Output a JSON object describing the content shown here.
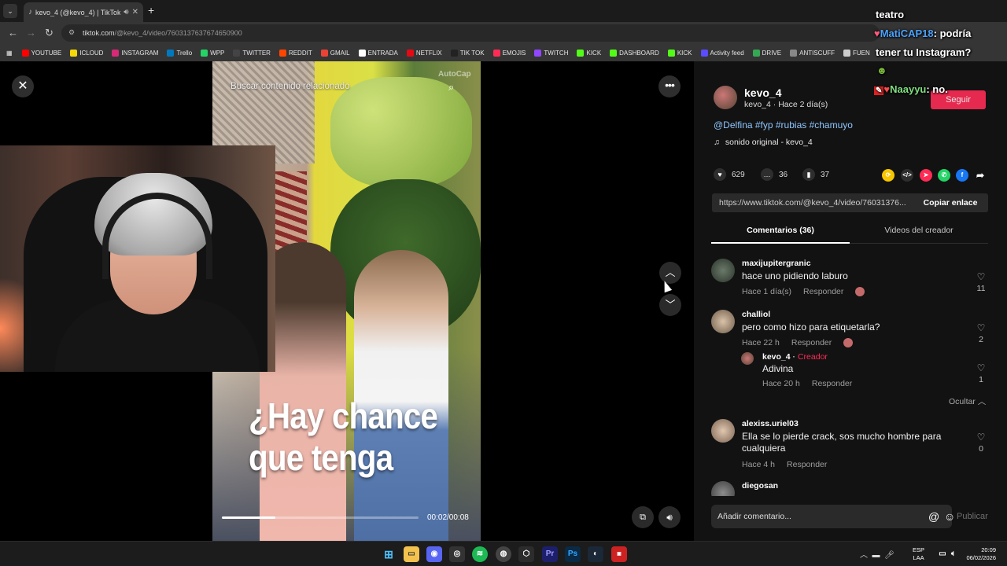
{
  "browser": {
    "tab_title": "kevo_4 (@kevo_4) | TikTok",
    "new_tab_icon": "plus-icon",
    "url_domain": "tiktok.com",
    "url_path": "/@kevo_4/video/7603137637674650900",
    "bookmarks": [
      {
        "label": "YOUTUBE",
        "color": "#ff0000"
      },
      {
        "label": "ICLOUD",
        "color": "#f5d90a"
      },
      {
        "label": "INSTAGRAM",
        "color": "#d62976"
      },
      {
        "label": "Trello",
        "color": "#0079bf"
      },
      {
        "label": "WPP",
        "color": "#25d366"
      },
      {
        "label": "TWITTER",
        "color": "#444444"
      },
      {
        "label": "REDDIT",
        "color": "#ff4500"
      },
      {
        "label": "GMAIL",
        "color": "#ea4335"
      },
      {
        "label": "ENTRADA",
        "color": "#ffffff"
      },
      {
        "label": "NETFLIX",
        "color": "#e50914"
      },
      {
        "label": "TIK TOK",
        "color": "#222222"
      },
      {
        "label": "EMOJIS",
        "color": "#fe2c55"
      },
      {
        "label": "TWITCH",
        "color": "#9146ff"
      },
      {
        "label": "KICK",
        "color": "#53fc18"
      },
      {
        "label": "DASHBOARD",
        "color": "#53fc18"
      },
      {
        "label": "KICK",
        "color": "#53fc18"
      },
      {
        "label": "Activity feed",
        "color": "#5a4cff"
      },
      {
        "label": "DRIVE",
        "color": "#34a853"
      },
      {
        "label": "ANTISCUFF",
        "color": "#888888"
      },
      {
        "label": "FUEN",
        "color": "#cccccc"
      }
    ]
  },
  "video": {
    "search_hint": "Buscar contenido relacionado",
    "autocap": "AutoCap",
    "caption_line1": "¿Hay chance",
    "caption_line2": "que tenga",
    "time": "00:02/00:08",
    "progress": 0.27
  },
  "panel": {
    "author_name": "kevo_4",
    "author_sub": "kevo_4 · Hace 2 día(s)",
    "follow_label": "Seguir",
    "tags": "@Delfina #fyp #rubias #chamuyo",
    "sound": "sonido original - kevo_4",
    "likes": "629",
    "comments_count": "36",
    "saves": "37",
    "share_link": "https://www.tiktok.com/@kevo_4/video/76031376...",
    "copy_link": "Copiar enlace",
    "tab_comments": "Comentarios (36)",
    "tab_creator": "Videos del creador",
    "reply_label": "Responder",
    "hide_label": "Ocultar",
    "add_comment": "Añadir comentario...",
    "publish": "Publicar"
  },
  "comments": [
    {
      "user": "maxijupitergranic",
      "text": "hace uno pidiendo laburo",
      "time": "Hace 1 día(s)",
      "likes": "11"
    },
    {
      "user": "challiol",
      "text": "pero como hizo para etiquetarla?",
      "time": "Hace 22 h",
      "likes": "2"
    },
    {
      "user": "kevo_4",
      "badge": "Creador",
      "text": "Adivina",
      "time": "Hace 20 h",
      "likes": "1"
    },
    {
      "user": "alexiss.uriel03",
      "text": "Ella se lo pierde crack, sos mucho hombre para cualquiera",
      "time": "Hace 4 h",
      "likes": "0"
    },
    {
      "user": "diegosan"
    }
  ],
  "chat": {
    "line0": "teatro",
    "line1_user": "MatiCAP18",
    "line1_text": ": podría",
    "line2": "tener tu Instagram?",
    "line3_user": "Naayyu",
    "line3_text": ":  no."
  },
  "taskbar": {
    "lang1": "ESP",
    "lang2": "LAA",
    "time": "20:09",
    "date": "06/02/2026"
  }
}
